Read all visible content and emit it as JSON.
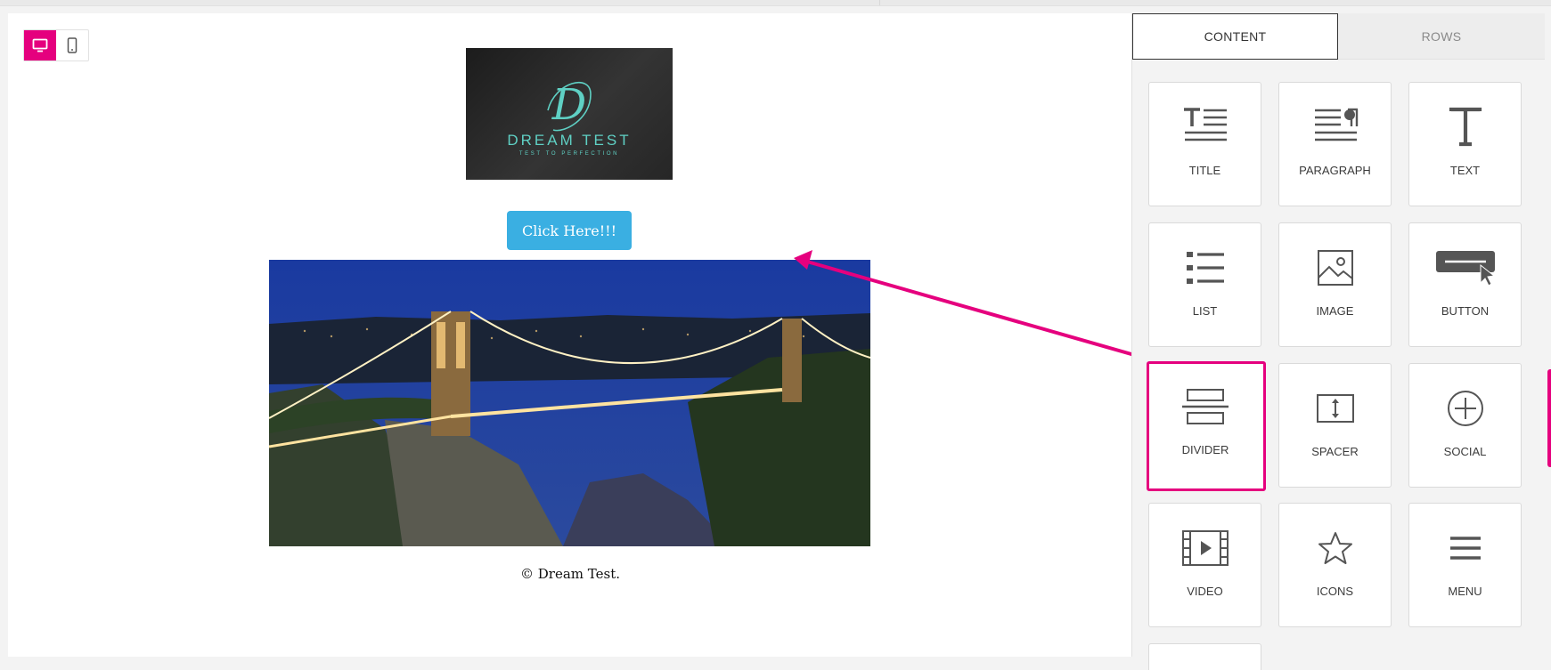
{
  "view_toggle": {
    "desktop_icon": "desktop-icon",
    "mobile_icon": "mobile-icon",
    "active": "desktop"
  },
  "email": {
    "logo": {
      "monogram": "D",
      "brand": "DREAM TEST",
      "tagline": "TEST TO PERFECTION"
    },
    "cta_label": "Click Here!!!",
    "hero_image_description": "Suspension bridge at night",
    "footer": "© Dream Test."
  },
  "panel": {
    "tabs": [
      {
        "label": "CONTENT",
        "active": true
      },
      {
        "label": "ROWS",
        "active": false
      }
    ],
    "tiles": [
      {
        "label": "TITLE",
        "icon": "title-icon"
      },
      {
        "label": "PARAGRAPH",
        "icon": "paragraph-icon"
      },
      {
        "label": "TEXT",
        "icon": "text-icon"
      },
      {
        "label": "LIST",
        "icon": "list-icon"
      },
      {
        "label": "IMAGE",
        "icon": "image-icon"
      },
      {
        "label": "BUTTON",
        "icon": "button-icon"
      },
      {
        "label": "DIVIDER",
        "icon": "divider-icon",
        "highlighted": true
      },
      {
        "label": "SPACER",
        "icon": "spacer-icon"
      },
      {
        "label": "SOCIAL",
        "icon": "social-icon"
      },
      {
        "label": "VIDEO",
        "icon": "video-icon"
      },
      {
        "label": "ICONS",
        "icon": "icons-icon"
      },
      {
        "label": "MENU",
        "icon": "menu-icon"
      }
    ]
  },
  "colors": {
    "accent": "#e5007e",
    "cta_background": "#3aafe2",
    "icon_gray": "#555555",
    "canvas_background": "#ffffff",
    "panel_background": "#f3f3f3"
  }
}
